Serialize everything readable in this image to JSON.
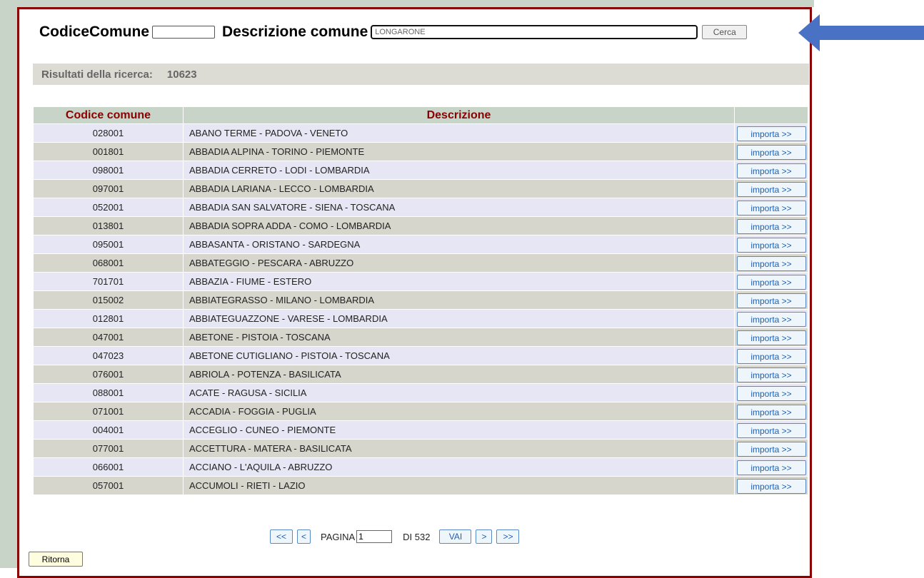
{
  "search": {
    "code_label": "CodiceComune",
    "code_value": "",
    "desc_label": "Descrizione comune",
    "desc_value": "LONGARONE",
    "button": "Cerca"
  },
  "results": {
    "label": "Risultati della ricerca:",
    "count": "10623"
  },
  "table": {
    "headers": [
      "Codice comune",
      "Descrizione",
      ""
    ],
    "import_label": "importa >>",
    "rows": [
      {
        "code": "028001",
        "desc": "ABANO TERME - PADOVA - VENETO"
      },
      {
        "code": "001801",
        "desc": "ABBADIA ALPINA - TORINO - PIEMONTE"
      },
      {
        "code": "098001",
        "desc": "ABBADIA CERRETO - LODI - LOMBARDIA"
      },
      {
        "code": "097001",
        "desc": "ABBADIA LARIANA - LECCO - LOMBARDIA"
      },
      {
        "code": "052001",
        "desc": "ABBADIA SAN SALVATORE - SIENA - TOSCANA"
      },
      {
        "code": "013801",
        "desc": "ABBADIA SOPRA ADDA - COMO - LOMBARDIA"
      },
      {
        "code": "095001",
        "desc": "ABBASANTA - ORISTANO - SARDEGNA"
      },
      {
        "code": "068001",
        "desc": "ABBATEGGIO - PESCARA - ABRUZZO"
      },
      {
        "code": "701701",
        "desc": "ABBAZIA - FIUME - ESTERO"
      },
      {
        "code": "015002",
        "desc": "ABBIATEGRASSO - MILANO - LOMBARDIA"
      },
      {
        "code": "012801",
        "desc": "ABBIATEGUAZZONE - VARESE - LOMBARDIA"
      },
      {
        "code": "047001",
        "desc": "ABETONE - PISTOIA - TOSCANA"
      },
      {
        "code": "047023",
        "desc": "ABETONE CUTIGLIANO - PISTOIA - TOSCANA"
      },
      {
        "code": "076001",
        "desc": "ABRIOLA - POTENZA - BASILICATA"
      },
      {
        "code": "088001",
        "desc": "ACATE - RAGUSA - SICILIA"
      },
      {
        "code": "071001",
        "desc": "ACCADIA - FOGGIA - PUGLIA"
      },
      {
        "code": "004001",
        "desc": "ACCEGLIO - CUNEO - PIEMONTE"
      },
      {
        "code": "077001",
        "desc": "ACCETTURA - MATERA - BASILICATA"
      },
      {
        "code": "066001",
        "desc": "ACCIANO - L'AQUILA - ABRUZZO"
      },
      {
        "code": "057001",
        "desc": "ACCUMOLI - RIETI - LAZIO"
      }
    ]
  },
  "pager": {
    "first": "<<",
    "prev": "<",
    "page_label": "PAGINA",
    "page_value": "1",
    "total_label": "DI 532",
    "go": "VAI",
    "next": ">",
    "last": ">>"
  },
  "back_button": "Ritorna",
  "colors": {
    "frame": "#8b0000",
    "header_bg": "#c9d4c9",
    "row_odd": "#e6e6f5",
    "row_even": "#d6d6cc",
    "arrow": "#4a72c4"
  }
}
